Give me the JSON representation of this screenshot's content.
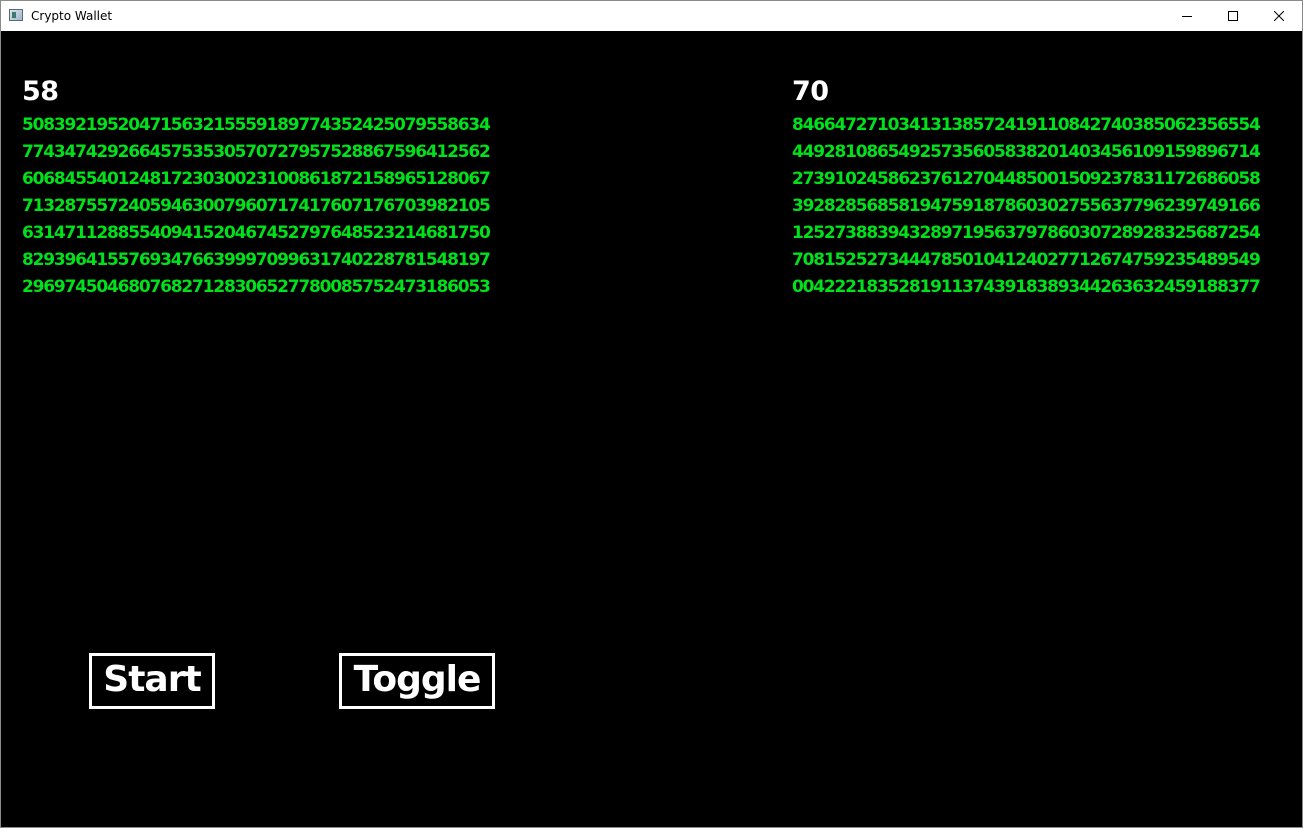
{
  "window": {
    "title": "Crypto Wallet",
    "icons": {
      "app": "app-window-icon",
      "minimize": "minimize-icon",
      "maximize": "maximize-icon",
      "close": "close-icon"
    }
  },
  "colors": {
    "background": "#000000",
    "count_text": "#ffffff",
    "number_text": "#00e01b",
    "button_border": "#ffffff"
  },
  "left_panel": {
    "count": "58",
    "lines": [
      "50839219520471563215559189774352425079558634",
      "77434742926645753530570727957528867596412562",
      "60684554012481723030023100861872158965128067",
      "71328755724059463007960717417607176703982105",
      "63147112885540941520467452797648523214681750",
      "82939641557693476639997099631740228781548197",
      "29697450468076827128306527780085752473186053"
    ]
  },
  "right_panel": {
    "count": "70",
    "lines": [
      "84664727103413138572419110842740385062356554",
      "44928108654925735605838201403456109159896714",
      "27391024586237612704485001509237831172686058",
      "39282856858194759187860302755637796239749166",
      "12527388394328971956379786030728928325687254",
      "70815252734447850104124027712674759235489549",
      "00422218352819113743918389344263632459188377"
    ]
  },
  "buttons": {
    "start_label": "Start",
    "toggle_label": "Toggle"
  }
}
